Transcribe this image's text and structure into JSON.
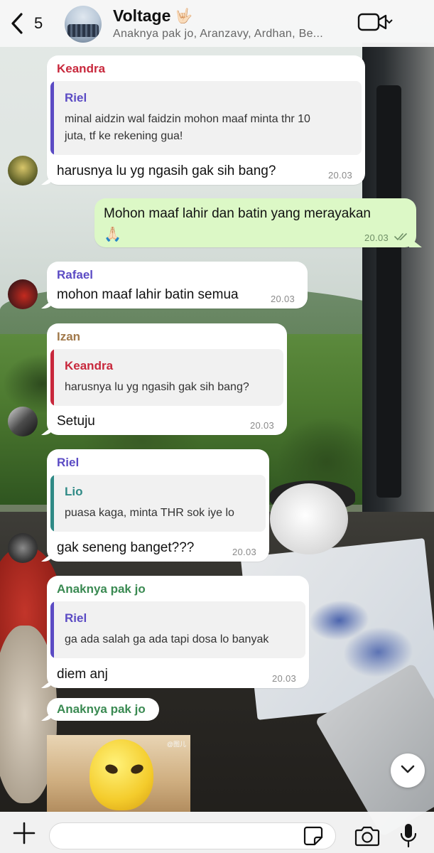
{
  "header": {
    "back_count": "5",
    "group_name": "Voltage",
    "group_emoji": "🤟🏻",
    "members": "Anaknya pak jo, Aranzavy, Ardhan, Be..."
  },
  "messages": [
    {
      "sender": "Keandra",
      "sender_color": "#c8283c",
      "quote": {
        "sender": "Riel",
        "sender_color": "#5b4bc4",
        "line1": "minal aidzin wal faidzin mohon maaf minta thr 10",
        "line2": "juta, tf ke rekening gua!"
      },
      "text": "harusnya lu yg ngasih gak sih bang?",
      "time": "20.03"
    },
    {
      "outgoing": true,
      "text": "Mohon maaf lahir dan batin yang merayakan",
      "emoji": "🙏🏻",
      "time": "20.03",
      "status": "read"
    },
    {
      "sender": "Rafael",
      "sender_color": "#5b4bc4",
      "text": "mohon maaf lahir batin semua",
      "time": "20.03"
    },
    {
      "sender": "Izan",
      "sender_color": "#a0784a",
      "quote": {
        "sender": "Keandra",
        "sender_color": "#c8283c",
        "line1": "harusnya lu yg ngasih gak sih bang?"
      },
      "text": "Setuju",
      "time": "20.03"
    },
    {
      "sender": "Riel",
      "sender_color": "#5b4bc4",
      "quote": {
        "sender": "Lio",
        "sender_color": "#2f8a86",
        "line1": "puasa kaga, minta THR sok iye lo"
      },
      "text": "gak seneng banget???",
      "time": "20.03"
    },
    {
      "sender": "Anaknya pak jo",
      "sender_color": "#3a8a52",
      "quote": {
        "sender": "Riel",
        "sender_color": "#5b4bc4",
        "line1": "ga ada salah ga ada tapi dosa lo banyak"
      },
      "text": "diem anj",
      "time": "20.03"
    },
    {
      "sender": "Anaknya pak jo",
      "sender_color": "#3a8a52",
      "sticker": "angry-yellow-blob-sticker",
      "sticker_tag": "@图儿"
    }
  ],
  "composer": {
    "placeholder": "",
    "value": ""
  },
  "icons": {
    "back": "chevron-left-icon",
    "video": "video-camera-icon",
    "plus": "plus-icon",
    "sticker": "sticker-icon",
    "camera": "camera-icon",
    "mic": "microphone-icon",
    "scroll": "chevron-down-icon"
  }
}
